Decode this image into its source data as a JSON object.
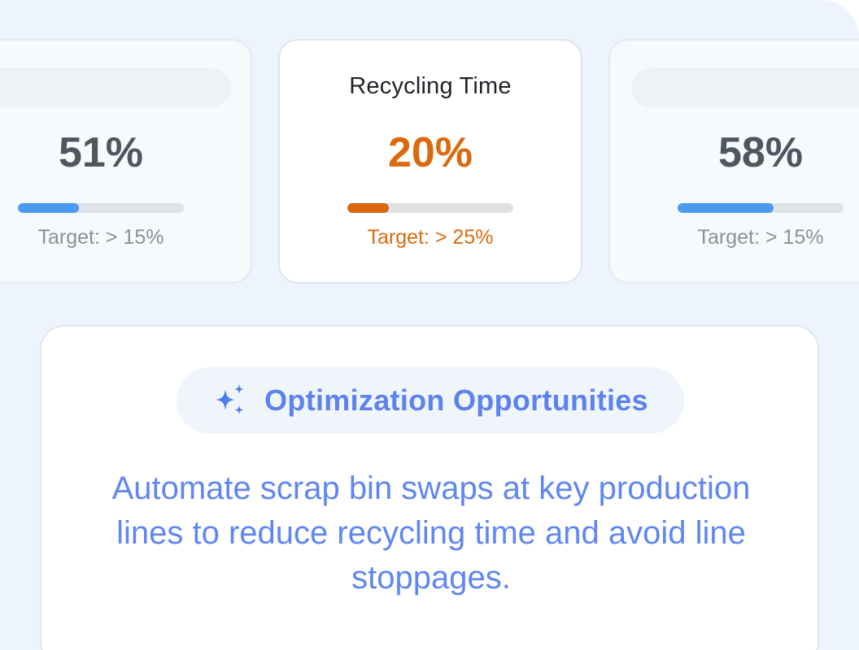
{
  "metrics": [
    {
      "title": "",
      "value": "51%",
      "progress": 0.37,
      "target": "Target: > 15%"
    },
    {
      "title": "Recycling Time",
      "value": "20%",
      "progress": 0.25,
      "target": "Target: > 25%"
    },
    {
      "title": "",
      "value": "58%",
      "progress": 0.58,
      "target": "Target: > 15%"
    }
  ],
  "optimization": {
    "title": "Optimization Opportunities",
    "icon": "sparkle-icon",
    "text": "Automate scrap bin swaps at key production lines to reduce recycling time and avoid line stoppages."
  },
  "colors": {
    "accent_orange": "#dc6a0d",
    "accent_blue": "#4a9af0",
    "opportunity_blue": "#5b82ee",
    "background": "#edf4fd"
  }
}
